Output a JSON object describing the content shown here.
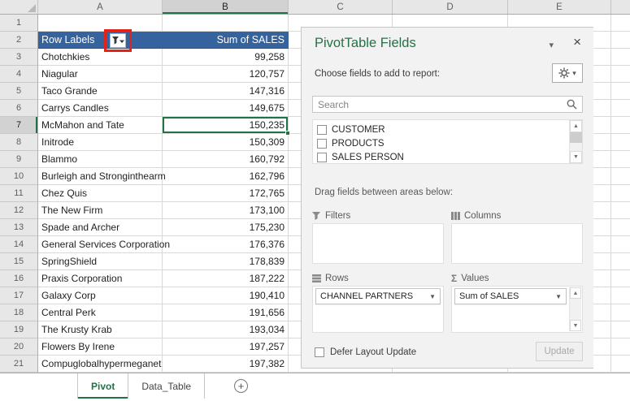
{
  "colors": {
    "accent_green": "#217346",
    "pivot_header_blue": "#35639D",
    "annotation_red": "#E2231A"
  },
  "icons": {
    "close": "×",
    "dropdown_caret": "▾",
    "pill_caret": "▼",
    "scroll_up": "▲",
    "scroll_down": "▼",
    "sigma": "Σ",
    "plus": "+"
  },
  "spreadsheet": {
    "column_headers": [
      "A",
      "B",
      "C",
      "D",
      "E"
    ],
    "selection": {
      "cell": "B7",
      "row": 7,
      "col": "B"
    },
    "pivot_header": {
      "row_labels": "Row Labels",
      "values": "Sum of SALES"
    },
    "grid_rows": [
      {
        "num": 1,
        "a": "",
        "b": "",
        "kind": "empty"
      },
      {
        "num": 2,
        "a": "Row Labels",
        "b": "Sum of SALES",
        "kind": "header"
      },
      {
        "num": 3,
        "a": "Chotchkies",
        "b": "99,258",
        "kind": "data"
      },
      {
        "num": 4,
        "a": "Niagular",
        "b": "120,757",
        "kind": "data"
      },
      {
        "num": 5,
        "a": "Taco Grande",
        "b": "147,316",
        "kind": "data"
      },
      {
        "num": 6,
        "a": "Carrys Candles",
        "b": "149,675",
        "kind": "data"
      },
      {
        "num": 7,
        "a": "McMahon and Tate",
        "b": "150,235",
        "kind": "data"
      },
      {
        "num": 8,
        "a": "Initrode",
        "b": "150,309",
        "kind": "data"
      },
      {
        "num": 9,
        "a": "Blammo",
        "b": "160,792",
        "kind": "data"
      },
      {
        "num": 10,
        "a": "Burleigh and Stronginthearm",
        "b": "162,796",
        "kind": "data"
      },
      {
        "num": 11,
        "a": "Chez Quis",
        "b": "172,765",
        "kind": "data"
      },
      {
        "num": 12,
        "a": "The New Firm",
        "b": "173,100",
        "kind": "data"
      },
      {
        "num": 13,
        "a": "Spade and Archer",
        "b": "175,230",
        "kind": "data"
      },
      {
        "num": 14,
        "a": "General Services Corporation",
        "b": "176,376",
        "kind": "data"
      },
      {
        "num": 15,
        "a": "SpringShield",
        "b": "178,839",
        "kind": "data"
      },
      {
        "num": 16,
        "a": "Praxis Corporation",
        "b": "187,222",
        "kind": "data"
      },
      {
        "num": 17,
        "a": "Galaxy Corp",
        "b": "190,410",
        "kind": "data"
      },
      {
        "num": 18,
        "a": "Central Perk",
        "b": "191,656",
        "kind": "data"
      },
      {
        "num": 19,
        "a": "The Krusty Krab",
        "b": "193,034",
        "kind": "data"
      },
      {
        "num": 20,
        "a": "Flowers By Irene",
        "b": "197,257",
        "kind": "data"
      },
      {
        "num": 21,
        "a": "Compuglobalhypermeganet",
        "b": "197,382",
        "kind": "data"
      }
    ]
  },
  "fields_panel": {
    "title": "PivotTable Fields",
    "choose_fields_label": "Choose fields to add to report:",
    "search_placeholder": "Search",
    "fields": [
      "CUSTOMER",
      "PRODUCTS",
      "SALES PERSON"
    ],
    "drag_fields_label": "Drag fields between areas below:",
    "areas": {
      "filters_label": "Filters",
      "columns_label": "Columns",
      "rows_label": "Rows",
      "values_label": "Values",
      "rows_item": "CHANNEL PARTNERS",
      "values_item": "Sum of SALES"
    },
    "defer_layout_label": "Defer Layout Update",
    "update_button": "Update"
  },
  "sheet_tabs": {
    "tabs": [
      {
        "label": "Pivot",
        "active": true
      },
      {
        "label": "Data_Table",
        "active": false
      }
    ]
  }
}
